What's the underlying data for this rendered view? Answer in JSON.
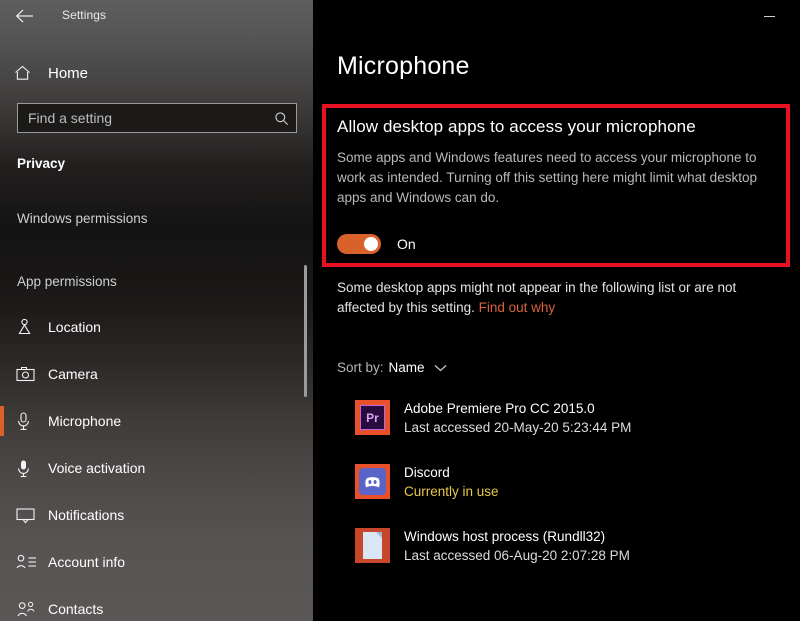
{
  "sidebar": {
    "titlebar": {
      "back_icon": "back-arrow-icon",
      "title": "Settings"
    },
    "home": {
      "icon": "home-icon",
      "label": "Home"
    },
    "search": {
      "placeholder": "Find a setting",
      "value": "",
      "icon": "search-icon"
    },
    "section_title": "Privacy",
    "groups": [
      {
        "label": "Windows permissions"
      },
      {
        "label": "App permissions"
      }
    ],
    "items": [
      {
        "label": "Location",
        "icon": "location-pin-icon",
        "selected": false
      },
      {
        "label": "Camera",
        "icon": "camera-icon",
        "selected": false
      },
      {
        "label": "Microphone",
        "icon": "microphone-icon",
        "selected": true
      },
      {
        "label": "Voice activation",
        "icon": "microphone-stand-icon",
        "selected": false
      },
      {
        "label": "Notifications",
        "icon": "speech-bubble-icon",
        "selected": false
      },
      {
        "label": "Account info",
        "icon": "account-info-icon",
        "selected": false
      },
      {
        "label": "Contacts",
        "icon": "contacts-icon",
        "selected": false
      }
    ],
    "accent_color": "#d9622b"
  },
  "main": {
    "minimize_icon": "minimize-icon",
    "page_title": "Microphone",
    "highlight": {
      "border_color": "#e81123",
      "heading": "Allow desktop apps to access your microphone",
      "description": "Some apps and Windows features need to access your microphone to work as intended. Turning off this setting here might limit what desktop apps and Windows can do.",
      "toggle": {
        "state_label": "On",
        "on": true,
        "color": "#d9622b"
      }
    },
    "note": {
      "text": "Some desktop apps might not appear in the following list or are not affected by this setting.",
      "link_text": "Find out why",
      "link_color": "#d9623a"
    },
    "sort": {
      "label": "Sort by:",
      "value": "Name",
      "chevron_icon": "chevron-down-icon"
    },
    "apps": [
      {
        "name": "Adobe Premiere Pro CC 2015.0",
        "status": "Last accessed 20-May-20 5:23:44 PM",
        "in_use": false,
        "icon": "adobe-premiere-icon",
        "icon_text": "Pr"
      },
      {
        "name": "Discord",
        "status": "Currently in use",
        "in_use": true,
        "icon": "discord-icon",
        "icon_text": ""
      },
      {
        "name": "Windows host process (Rundll32)",
        "status": "Last accessed 06-Aug-20 2:07:28 PM",
        "in_use": false,
        "icon": "document-icon",
        "icon_text": ""
      }
    ]
  }
}
